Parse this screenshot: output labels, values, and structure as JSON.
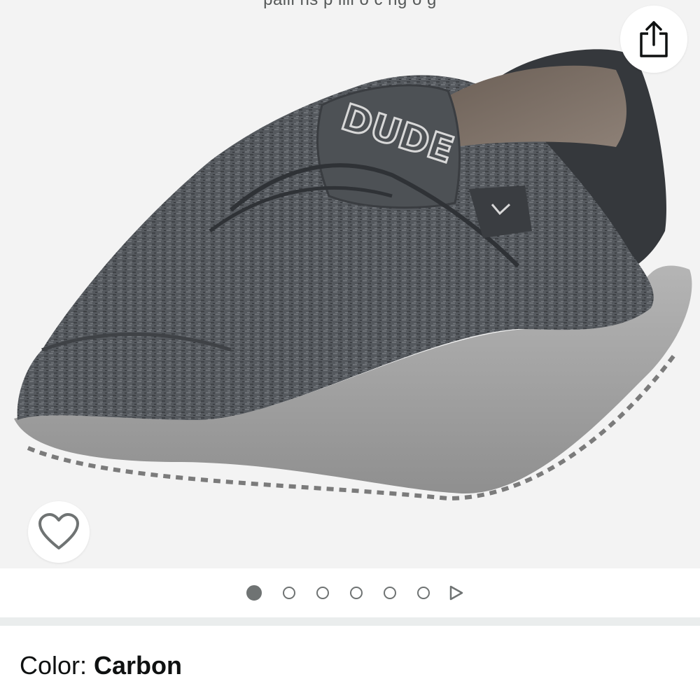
{
  "gallery": {
    "cut_off_text": "palli  ns  p   illl  o  c  ng  o  g",
    "image_count": 6,
    "active_index": 0
  },
  "icons": {
    "share": "share-icon",
    "wishlist": "heart-icon",
    "next": "play-arrow-icon"
  },
  "product": {
    "color_label": "Color: ",
    "color_value": "Carbon",
    "logo_text": "DUDE"
  },
  "colors": {
    "gallery_bg": "#f3f3f3",
    "upper": "#55595e",
    "sole": "#a9a9a9",
    "dot": "#6f7373"
  }
}
